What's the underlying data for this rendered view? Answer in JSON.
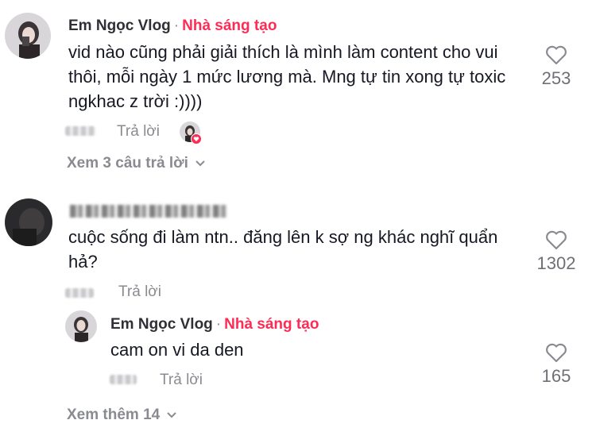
{
  "comments": [
    {
      "author": "Em Ngọc Vlog",
      "separator": "·",
      "badge": "Nhà sáng tạo",
      "text": "vid nào cũng phải giải thích là mình làm content cho vui thôi, mỗi ngày 1 mức lương mà. Mng tự tin xong tự toxic ngkhac z trời :))))",
      "reply_label": "Trả lời",
      "likes": "253",
      "view_replies": "Xem 3 câu trả lời"
    },
    {
      "text": "cuộc sống đi làm ntn.. đăng lên k sợ ng khác nghĩ quẩn hả?",
      "reply_label": "Trả lời",
      "likes": "1302",
      "reply": {
        "author": "Em Ngọc Vlog",
        "separator": "·",
        "badge": "Nhà sáng tạo",
        "text": "cam on vi da den",
        "reply_label": "Trả lời",
        "likes": "165"
      },
      "view_more": "Xem thêm 14"
    }
  ],
  "icons": {
    "like": "heart-outline-icon",
    "expand": "chevron-down-icon"
  },
  "colors": {
    "badge": "#fe2c55",
    "secondary_text": "#8a8b91",
    "primary_text": "#161823"
  }
}
